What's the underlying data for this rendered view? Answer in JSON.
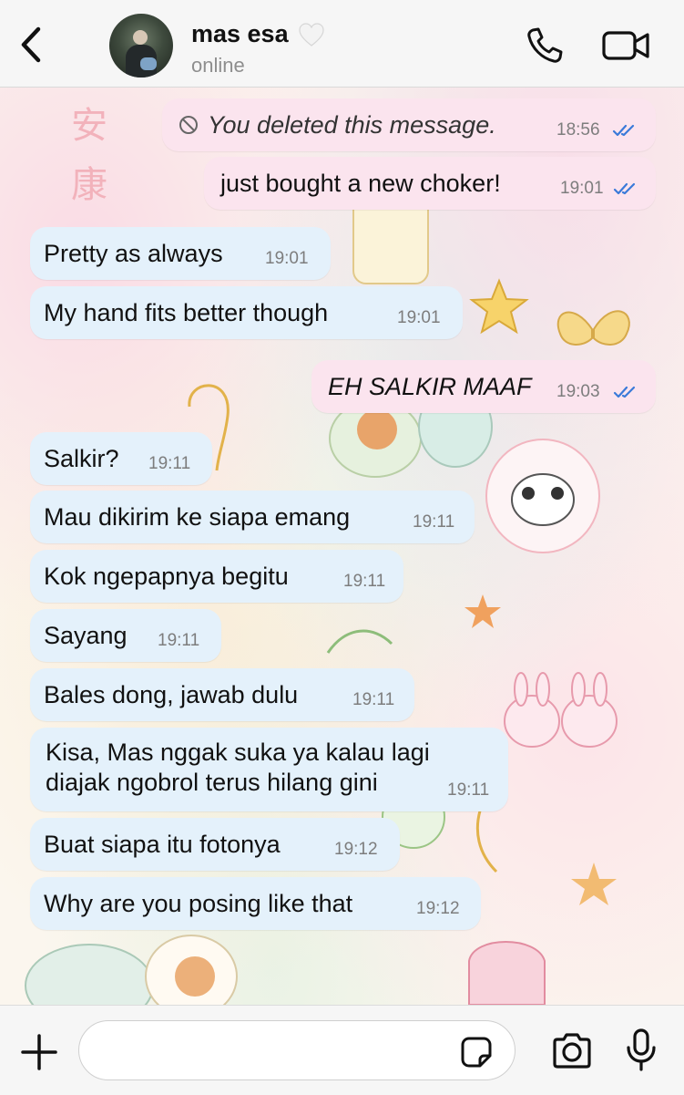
{
  "header": {
    "contact_name": "mas esa",
    "status": "online",
    "icons": [
      "back-chevron-icon",
      "white-heart-icon",
      "phone-icon",
      "video-camera-icon"
    ]
  },
  "messages": [
    {
      "dir": "out",
      "text": "You deleted this message.",
      "time": "18:56",
      "read": true,
      "deleted": true
    },
    {
      "dir": "out",
      "text": "just bought a new choker!",
      "time": "19:01",
      "read": true
    },
    {
      "dir": "in",
      "text": "Pretty as always",
      "time": "19:01"
    },
    {
      "dir": "in",
      "text": "My hand fits better though",
      "time": "19:01"
    },
    {
      "dir": "out",
      "text": "EH SALKIR MAAF",
      "time": "19:03",
      "read": true
    },
    {
      "dir": "in",
      "text": "Salkir?",
      "time": "19:11"
    },
    {
      "dir": "in",
      "text": "Mau dikirim ke siapa emang",
      "time": "19:11"
    },
    {
      "dir": "in",
      "text": "Kok ngepapnya begitu",
      "time": "19:11"
    },
    {
      "dir": "in",
      "text": "Sayang",
      "time": "19:11"
    },
    {
      "dir": "in",
      "text": "Bales dong, jawab dulu",
      "time": "19:11"
    },
    {
      "dir": "in",
      "text_line1": "Kisa, Mas nggak suka ya kalau lagi",
      "text_line2": "diajak ngobrol terus hilang gini",
      "time": "19:11"
    },
    {
      "dir": "in",
      "text": "Buat siapa itu fotonya",
      "time": "19:12"
    },
    {
      "dir": "in",
      "text": "Why are you posing like that",
      "time": "19:12"
    }
  ],
  "wallpaper": {
    "kanji": [
      "安",
      "康"
    ]
  },
  "composer": {
    "placeholder": "",
    "icons": [
      "plus-icon",
      "sticker-icon",
      "camera-icon",
      "microphone-icon"
    ]
  },
  "colors": {
    "incoming_bubble": "#e4f1fb",
    "outgoing_bubble": "#fbe4ee",
    "read_ticks": "#3a7ad9"
  }
}
